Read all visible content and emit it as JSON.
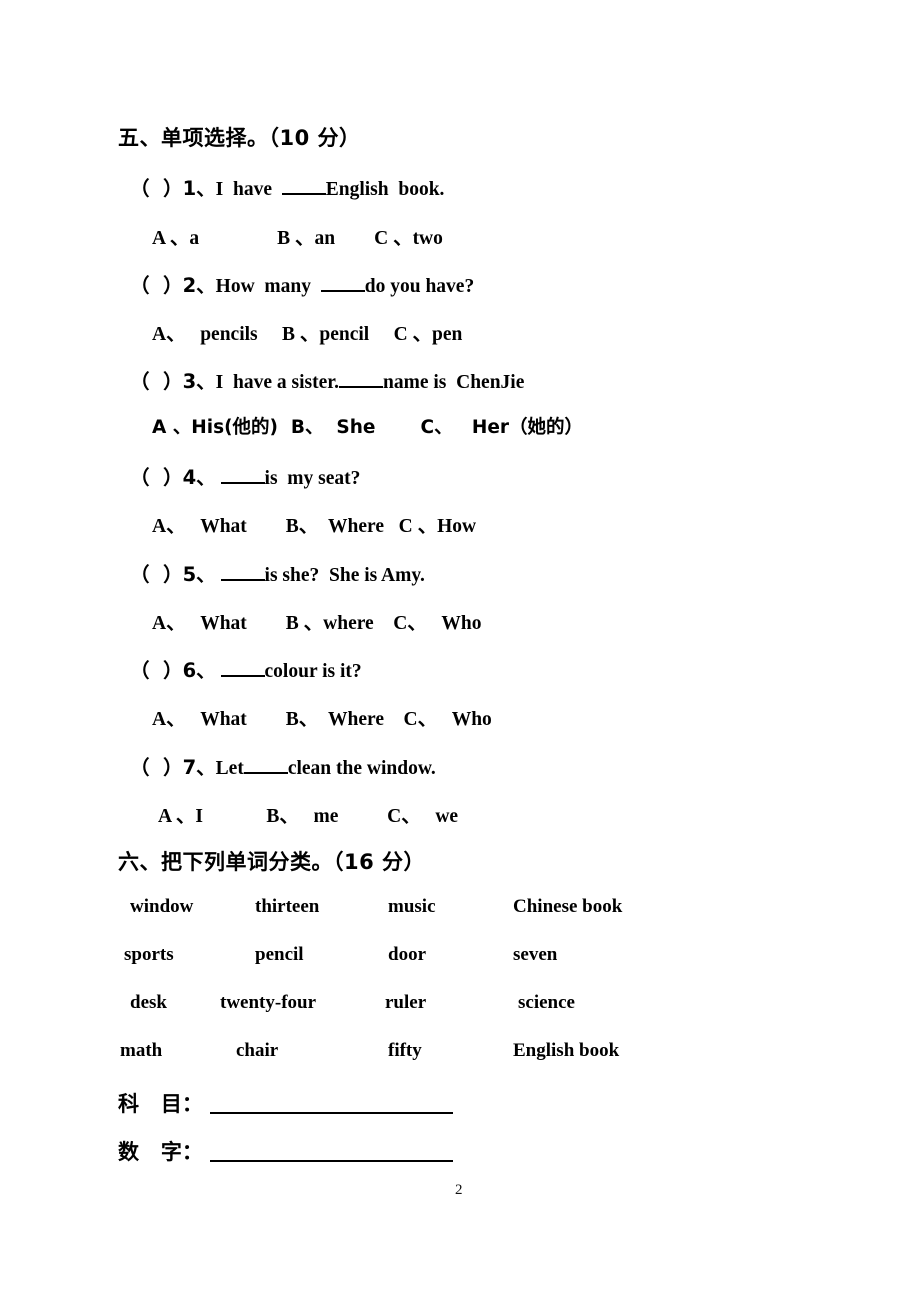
{
  "page": {
    "number": "2"
  },
  "sections": [
    {
      "id": "section-five",
      "heading": "五、单项选择。（10 分）",
      "questions": [
        {
          "marker": "（  ）",
          "number": "1、",
          "stem_before": "I  have  ",
          "stem_after": "English  book.",
          "options": "A 、a                B 、an        C 、two"
        },
        {
          "marker": "（  ）",
          "number": "2、",
          "stem_before": "How  many  ",
          "stem_after": "do you have?",
          "options": "A、   pencils     B 、pencil     C 、pen"
        },
        {
          "marker": "（  ）",
          "number": "3、",
          "stem_before": "I  have a sister.",
          "stem_after": "name is  ChenJie",
          "options": "A 、His(他的)  B、  She       C、   Her（她的）"
        },
        {
          "marker": "（  ）",
          "number": "4、",
          "stem_before": " ",
          "stem_after": "is  my seat?",
          "options": "A、   What        B、  Where   C 、How"
        },
        {
          "marker": "（  ）",
          "number": "5、",
          "stem_before": " ",
          "stem_after": "is she?  She is Amy.",
          "options": "A、   What        B 、where    C、   Who"
        },
        {
          "marker": "（  ）",
          "number": "6、",
          "stem_before": " ",
          "stem_after": "colour is it?",
          "options": "A、   What        B、  Where    C、   Who"
        },
        {
          "marker": "（  ）",
          "number": "7、",
          "stem_before": "Let",
          "stem_after": "clean the window.",
          "options": "A 、I             B、   me          C、   we"
        }
      ]
    },
    {
      "id": "section-six",
      "heading": "六、把下列单词分类。（16 分）",
      "word_bank": [
        [
          "window",
          "thirteen",
          "music",
          "Chinese book"
        ],
        [
          "sports",
          "pencil",
          "door",
          "seven"
        ],
        [
          "desk",
          "twenty-four",
          "ruler",
          "science"
        ],
        [
          "math",
          "chair",
          "fifty",
          "English book"
        ]
      ],
      "answer_rows": [
        {
          "label": "科   目："
        },
        {
          "label": "数   字："
        }
      ]
    }
  ]
}
